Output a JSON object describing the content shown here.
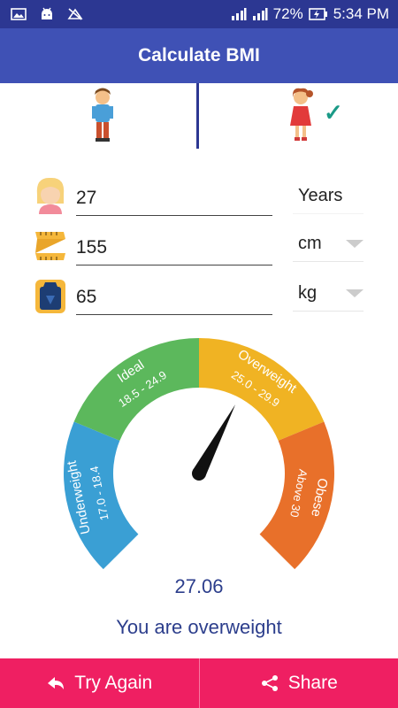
{
  "status_bar": {
    "battery": "72%",
    "time": "5:34 PM"
  },
  "app_bar": {
    "title": "Calculate BMI"
  },
  "gender": {
    "selected": "female"
  },
  "fields": {
    "age": {
      "value": "27",
      "unit": "Years"
    },
    "height": {
      "value": "155",
      "unit": "cm"
    },
    "weight": {
      "value": "65",
      "unit": "kg"
    }
  },
  "gauge": {
    "segments": [
      {
        "name": "Underweight",
        "range": "17.0 - 18.4",
        "color": "#3a9fd4"
      },
      {
        "name": "Ideal",
        "range": "18.5 - 24.9",
        "color": "#5cb85c"
      },
      {
        "name": "Overweight",
        "range": "25.0 - 29.9",
        "color": "#f0b323"
      },
      {
        "name": "Obese",
        "range": "Above 30",
        "color": "#e8702a"
      }
    ],
    "needle_value": 27.06
  },
  "result": {
    "bmi": "27.06",
    "message": "You are overweight"
  },
  "buttons": {
    "try_again": "Try Again",
    "share": "Share"
  },
  "colors": {
    "appbar": "#3f51b5",
    "statusbar": "#2c3792",
    "accent": "#ef1f62",
    "text_blue": "#2c3e8c"
  }
}
